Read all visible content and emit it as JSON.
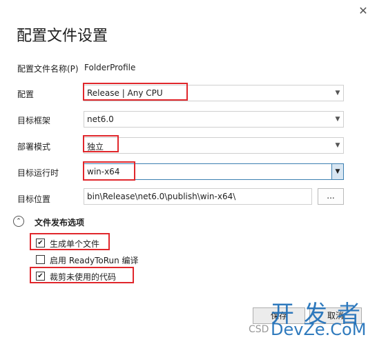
{
  "dialog": {
    "title": "配置文件设置",
    "close_glyph": "✕"
  },
  "profile_name": {
    "label": "配置文件名称(P)",
    "value": "FolderProfile"
  },
  "configuration": {
    "label": "配置",
    "value": "Release | Any CPU"
  },
  "target_framework": {
    "label": "目标框架",
    "value": "net6.0"
  },
  "deployment_mode": {
    "label": "部署模式",
    "value": "独立"
  },
  "target_runtime": {
    "label": "目标运行时",
    "value": "win-x64"
  },
  "target_location": {
    "label": "目标位置",
    "value": "bin\\Release\\net6.0\\publish\\win-x64\\",
    "browse_label": "..."
  },
  "file_publish_options": {
    "title": "文件发布选项",
    "toggle_glyph": "⌃",
    "options": [
      {
        "label": "生成单个文件",
        "checked": true,
        "mark": "✔"
      },
      {
        "label": "启用 ReadyToRun 编译",
        "checked": false,
        "mark": ""
      },
      {
        "label": "裁剪未使用的代码",
        "checked": true,
        "mark": "✔"
      }
    ]
  },
  "buttons": {
    "save_label": "保存",
    "cancel_label": "取消"
  },
  "watermark": {
    "big": "开发者",
    "small": "DevZe.CoM",
    "prefix": "CSD"
  },
  "colors": {
    "highlight_red": "#e0262b",
    "accent_blue": "#3c7fb1",
    "watermark_blue": "#1e6fb8"
  }
}
